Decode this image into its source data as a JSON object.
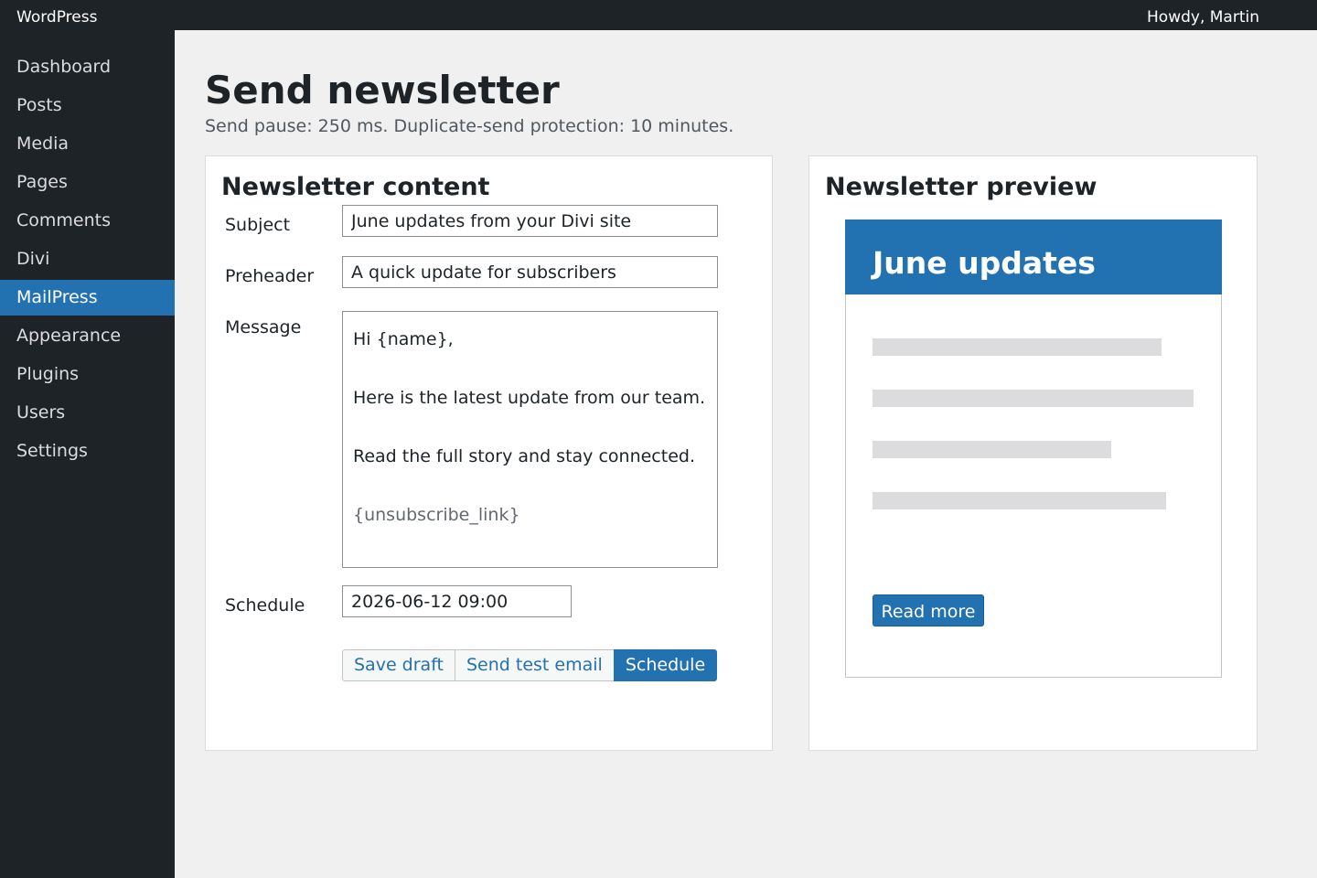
{
  "adminbar": {
    "site": "WordPress",
    "howdy": "Howdy, Martin"
  },
  "sidebar": {
    "items": [
      {
        "label": "Dashboard"
      },
      {
        "label": "Posts"
      },
      {
        "label": "Media"
      },
      {
        "label": "Pages"
      },
      {
        "label": "Comments"
      },
      {
        "label": "Divi"
      },
      {
        "label": "MailPress",
        "active": true
      },
      {
        "label": "Appearance"
      },
      {
        "label": "Plugins"
      },
      {
        "label": "Users"
      },
      {
        "label": "Settings"
      }
    ]
  },
  "page": {
    "title": "Send newsletter",
    "subtitle": "Send pause: 250 ms. Duplicate-send protection: 10 minutes."
  },
  "content": {
    "heading": "Newsletter content",
    "subject_label": "Subject",
    "subject_value": "June updates from your Divi site",
    "preheader_label": "Preheader",
    "preheader_value": "A quick update for subscribers",
    "message_label": "Message",
    "message_lines": [
      "Hi {name},",
      "Here is the latest update from our team.",
      "Read the full story and stay connected.",
      "{unsubscribe_link}"
    ],
    "schedule_label": "Schedule",
    "schedule_value": "2026-06-12 09:00",
    "buttons": {
      "save_draft": "Save draft",
      "send_test": "Send test email",
      "schedule": "Schedule"
    }
  },
  "preview": {
    "heading": "Newsletter preview",
    "email_title": "June updates",
    "read_more": "Read more"
  },
  "colors": {
    "accent": "#2271b1",
    "sidebar": "#1d2327",
    "background": "#f0f0f1"
  }
}
